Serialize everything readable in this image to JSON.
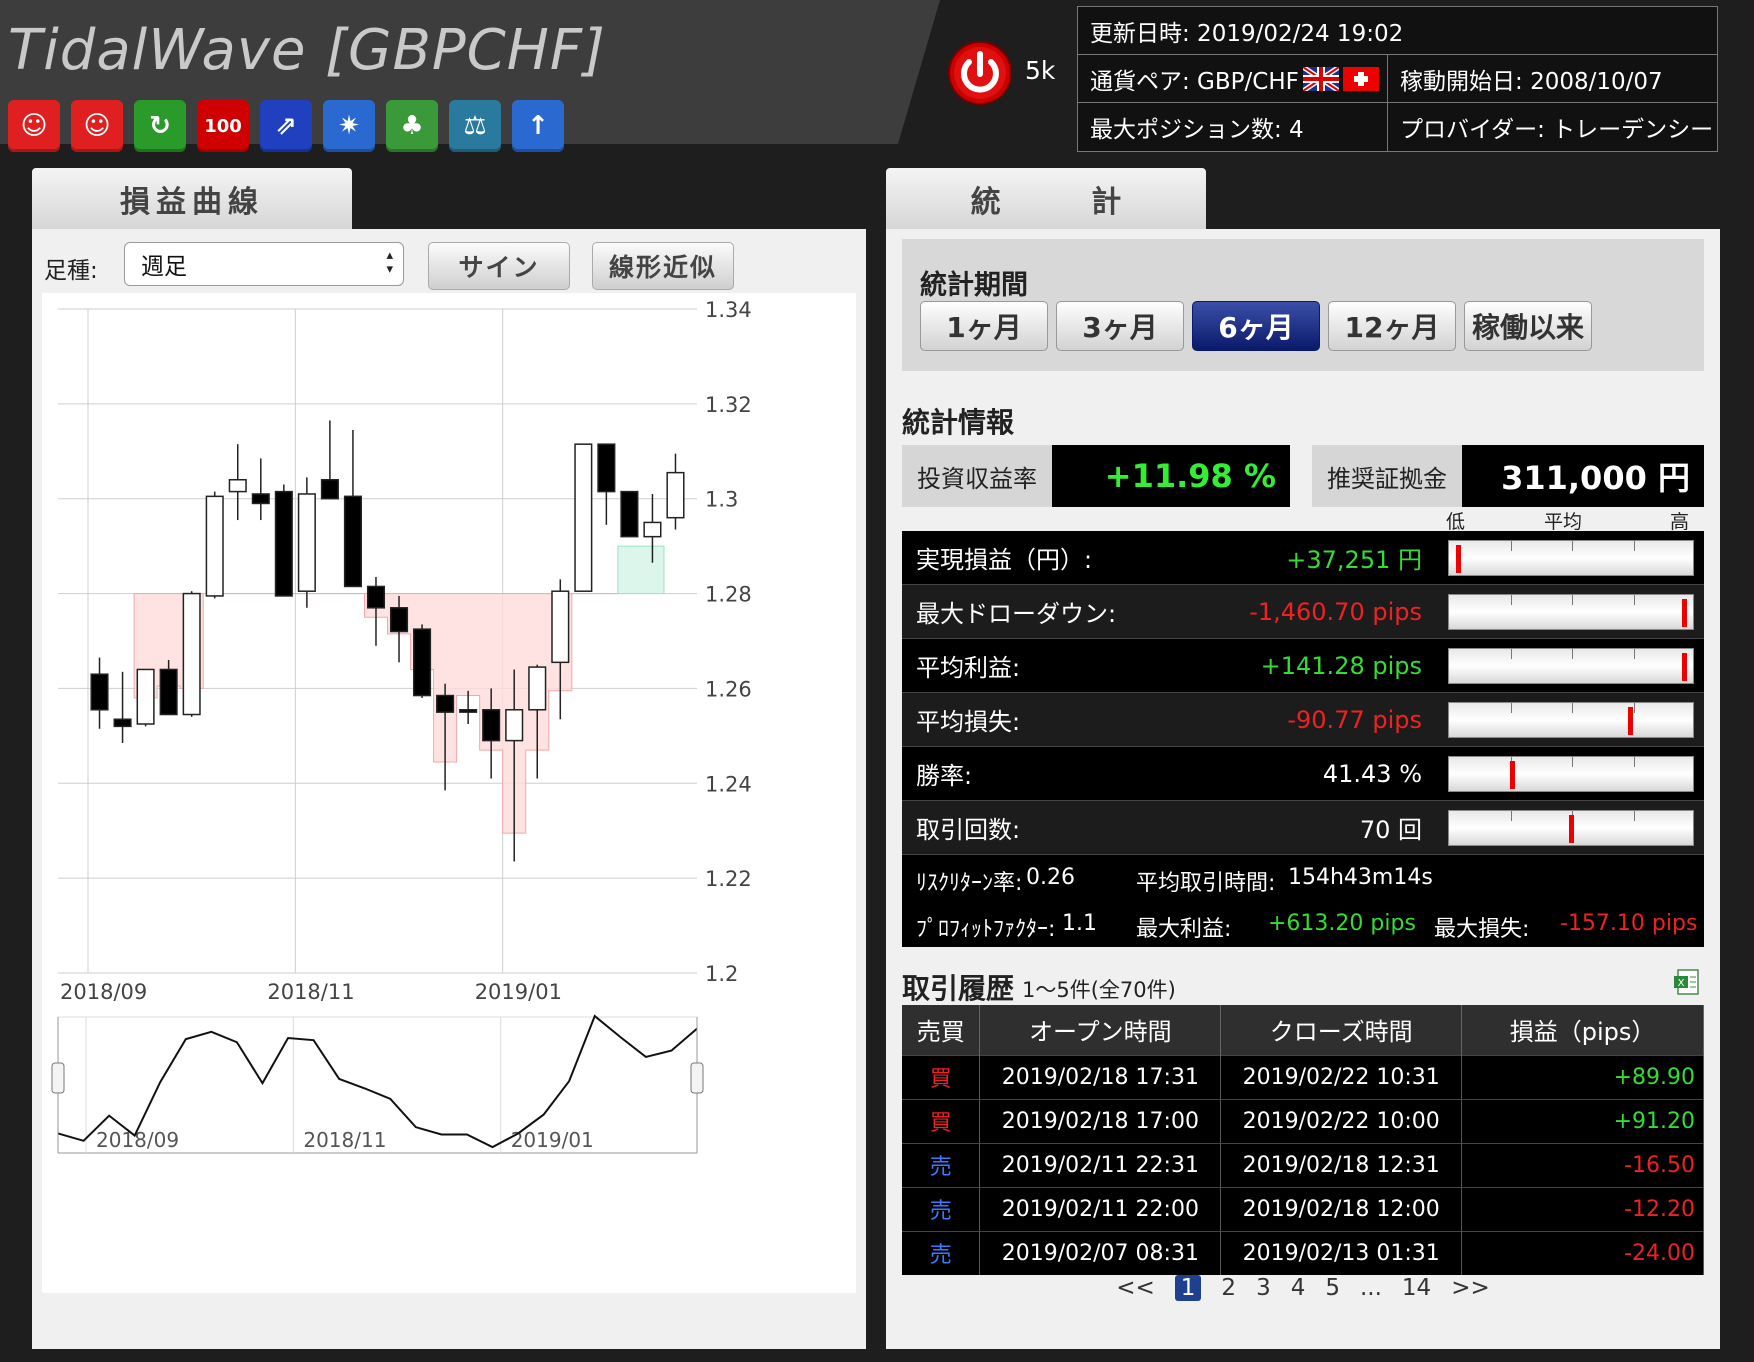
{
  "header": {
    "title": "TidalWave [GBPCHF]",
    "power_label": "5k",
    "badges": [
      {
        "icon": "star-face-icon",
        "color": "#e02020",
        "glyph": "☺"
      },
      {
        "icon": "smile-face-icon",
        "color": "#e02020",
        "glyph": "☺"
      },
      {
        "icon": "swirl-icon",
        "color": "#2a9a2a",
        "glyph": "↻"
      },
      {
        "icon": "hundred-icon",
        "color": "#d00000",
        "glyph": "100"
      },
      {
        "icon": "rocket-icon",
        "color": "#2040c0",
        "glyph": "⇗"
      },
      {
        "icon": "burst-icon",
        "color": "#2a6ad0",
        "glyph": "✷"
      },
      {
        "icon": "tree-icon",
        "color": "#3a9a3a",
        "glyph": "♣"
      },
      {
        "icon": "scale-icon",
        "color": "#2a7aa0",
        "glyph": "⚖"
      },
      {
        "icon": "arrow-up-icon",
        "color": "#2a6ad0",
        "glyph": "↑"
      }
    ],
    "info": {
      "updated": "更新日時: 2019/02/24 19:02",
      "pair": "通貨ペア: GBP/CHF",
      "start": "稼動開始日: 2008/10/07",
      "maxpos": "最大ポジション数: 4",
      "provider": "プロバイダー: トレーデンシー"
    }
  },
  "left": {
    "tab": "損益曲線",
    "ashi_label": "足種:",
    "ashi_value": "週足",
    "sign_button": "サイン",
    "linear_button": "線形近似"
  },
  "chart_data": {
    "type": "candlestick",
    "y_ticks": [
      "1.34",
      "1.32",
      "1.3",
      "1.28",
      "1.26",
      "1.24",
      "1.22",
      "1.2"
    ],
    "ylim": [
      1.2,
      1.34
    ],
    "x_ticks": [
      "2018/09",
      "2018/11",
      "2019/01"
    ],
    "navigator_x_ticks": [
      "2018/09",
      "2018/11",
      "2019/01"
    ],
    "candles": [
      {
        "o": 1.263,
        "h": 1.2665,
        "l": 1.2515,
        "c": 1.2555
      },
      {
        "o": 1.2535,
        "h": 1.2635,
        "l": 1.2485,
        "c": 1.252
      },
      {
        "o": 1.2525,
        "h": 1.264,
        "l": 1.252,
        "c": 1.264
      },
      {
        "o": 1.264,
        "h": 1.266,
        "l": 1.2545,
        "c": 1.2545
      },
      {
        "o": 1.2545,
        "h": 1.2805,
        "l": 1.254,
        "c": 1.28
      },
      {
        "o": 1.2795,
        "h": 1.3015,
        "l": 1.279,
        "c": 1.3005
      },
      {
        "o": 1.3015,
        "h": 1.3115,
        "l": 1.2955,
        "c": 1.304
      },
      {
        "o": 1.301,
        "h": 1.3085,
        "l": 1.2955,
        "c": 1.299
      },
      {
        "o": 1.3015,
        "h": 1.303,
        "l": 1.2795,
        "c": 1.2795
      },
      {
        "o": 1.2805,
        "h": 1.3045,
        "l": 1.277,
        "c": 1.301
      },
      {
        "o": 1.304,
        "h": 1.3165,
        "l": 1.3,
        "c": 1.3
      },
      {
        "o": 1.3005,
        "h": 1.3145,
        "l": 1.2815,
        "c": 1.2815
      },
      {
        "o": 1.2815,
        "h": 1.2835,
        "l": 1.269,
        "c": 1.277
      },
      {
        "o": 1.277,
        "h": 1.2795,
        "l": 1.2655,
        "c": 1.272
      },
      {
        "o": 1.2725,
        "h": 1.2735,
        "l": 1.258,
        "c": 1.2585
      },
      {
        "o": 1.2585,
        "h": 1.261,
        "l": 1.2385,
        "c": 1.255
      },
      {
        "o": 1.2555,
        "h": 1.2595,
        "l": 1.2525,
        "c": 1.255
      },
      {
        "o": 1.2555,
        "h": 1.26,
        "l": 1.241,
        "c": 1.249
      },
      {
        "o": 1.249,
        "h": 1.264,
        "l": 1.2235,
        "c": 1.2555
      },
      {
        "o": 1.2555,
        "h": 1.265,
        "l": 1.241,
        "c": 1.2645
      },
      {
        "o": 1.2655,
        "h": 1.283,
        "l": 1.2535,
        "c": 1.2805
      },
      {
        "o": 1.2805,
        "h": 1.3115,
        "l": 1.2805,
        "c": 1.3115
      },
      {
        "o": 1.3115,
        "h": 1.3115,
        "l": 1.2945,
        "c": 1.3015
      },
      {
        "o": 1.3015,
        "h": 1.3015,
        "l": 1.292,
        "c": 1.292
      },
      {
        "o": 1.292,
        "h": 1.301,
        "l": 1.2865,
        "c": 1.295
      },
      {
        "o": 1.296,
        "h": 1.3095,
        "l": 1.2935,
        "c": 1.3055
      }
    ]
  },
  "right": {
    "tab": "統 計",
    "period_label": "統計期間",
    "periods": [
      {
        "label": "1ヶ月",
        "active": false
      },
      {
        "label": "3ヶ月",
        "active": false
      },
      {
        "label": "6ヶ月",
        "active": true
      },
      {
        "label": "12ヶ月",
        "active": false
      },
      {
        "label": "稼働以来",
        "active": false
      }
    ],
    "stats_title": "統計情報",
    "roi_label": "投資収益率",
    "roi_value": "+11.98 %",
    "margin_label": "推奨証拠金",
    "margin_value": "311,000 円",
    "meter_head": {
      "low": "低",
      "avg": "平均",
      "high": "高"
    },
    "rows": [
      {
        "label": "実現損益（円）:",
        "value": "+37,251 円",
        "color": "#33dd33",
        "meter": 0.02
      },
      {
        "label": "最大ドローダウン:",
        "value": "-1,460.70 pips",
        "color": "#ee2222",
        "meter": 0.98
      },
      {
        "label": "平均利益:",
        "value": "+141.28 pips",
        "color": "#33dd33",
        "meter": 0.98
      },
      {
        "label": "平均損失:",
        "value": "-90.77 pips",
        "color": "#ee2222",
        "meter": 0.75
      },
      {
        "label": "勝率:",
        "value": "41.43 %",
        "color": "#ffffff",
        "meter": 0.25
      },
      {
        "label": "取引回数:",
        "value": "70 回",
        "color": "#ffffff",
        "meter": 0.5
      }
    ],
    "sub": {
      "rr_label": "ﾘｽｸﾘﾀｰﾝ率:",
      "rr_value": "0.26",
      "avg_time_label": "平均取引時間:",
      "avg_time_value": "154h43m14s",
      "pf_label": "ﾌﾟﾛﾌｨｯﾄﾌｧｸﾀｰ:",
      "pf_value": "1.1",
      "max_profit_label": "最大利益:",
      "max_profit_value": "+613.20 pips",
      "max_loss_label": "最大損失:",
      "max_loss_value": "-157.10 pips"
    },
    "history_title": "取引履歴",
    "history_count": "1～5件(全70件)",
    "history_headers": [
      "売買",
      "オープン時間",
      "クローズ時間",
      "損益（pips）"
    ],
    "history": [
      {
        "side": "買",
        "open": "2019/02/18 17:31",
        "close": "2019/02/22 10:31",
        "pl": "+89.90"
      },
      {
        "side": "買",
        "open": "2019/02/18 17:00",
        "close": "2019/02/22 10:00",
        "pl": "+91.20"
      },
      {
        "side": "売",
        "open": "2019/02/11 22:31",
        "close": "2019/02/18 12:31",
        "pl": "-16.50"
      },
      {
        "side": "売",
        "open": "2019/02/11 22:00",
        "close": "2019/02/18 12:00",
        "pl": "-12.20"
      },
      {
        "side": "売",
        "open": "2019/02/07 08:31",
        "close": "2019/02/13 01:31",
        "pl": "-24.00"
      }
    ],
    "pager": [
      "<<",
      "1",
      "2",
      "3",
      "4",
      "5",
      "...",
      "14",
      ">>"
    ],
    "pager_current": "1"
  }
}
